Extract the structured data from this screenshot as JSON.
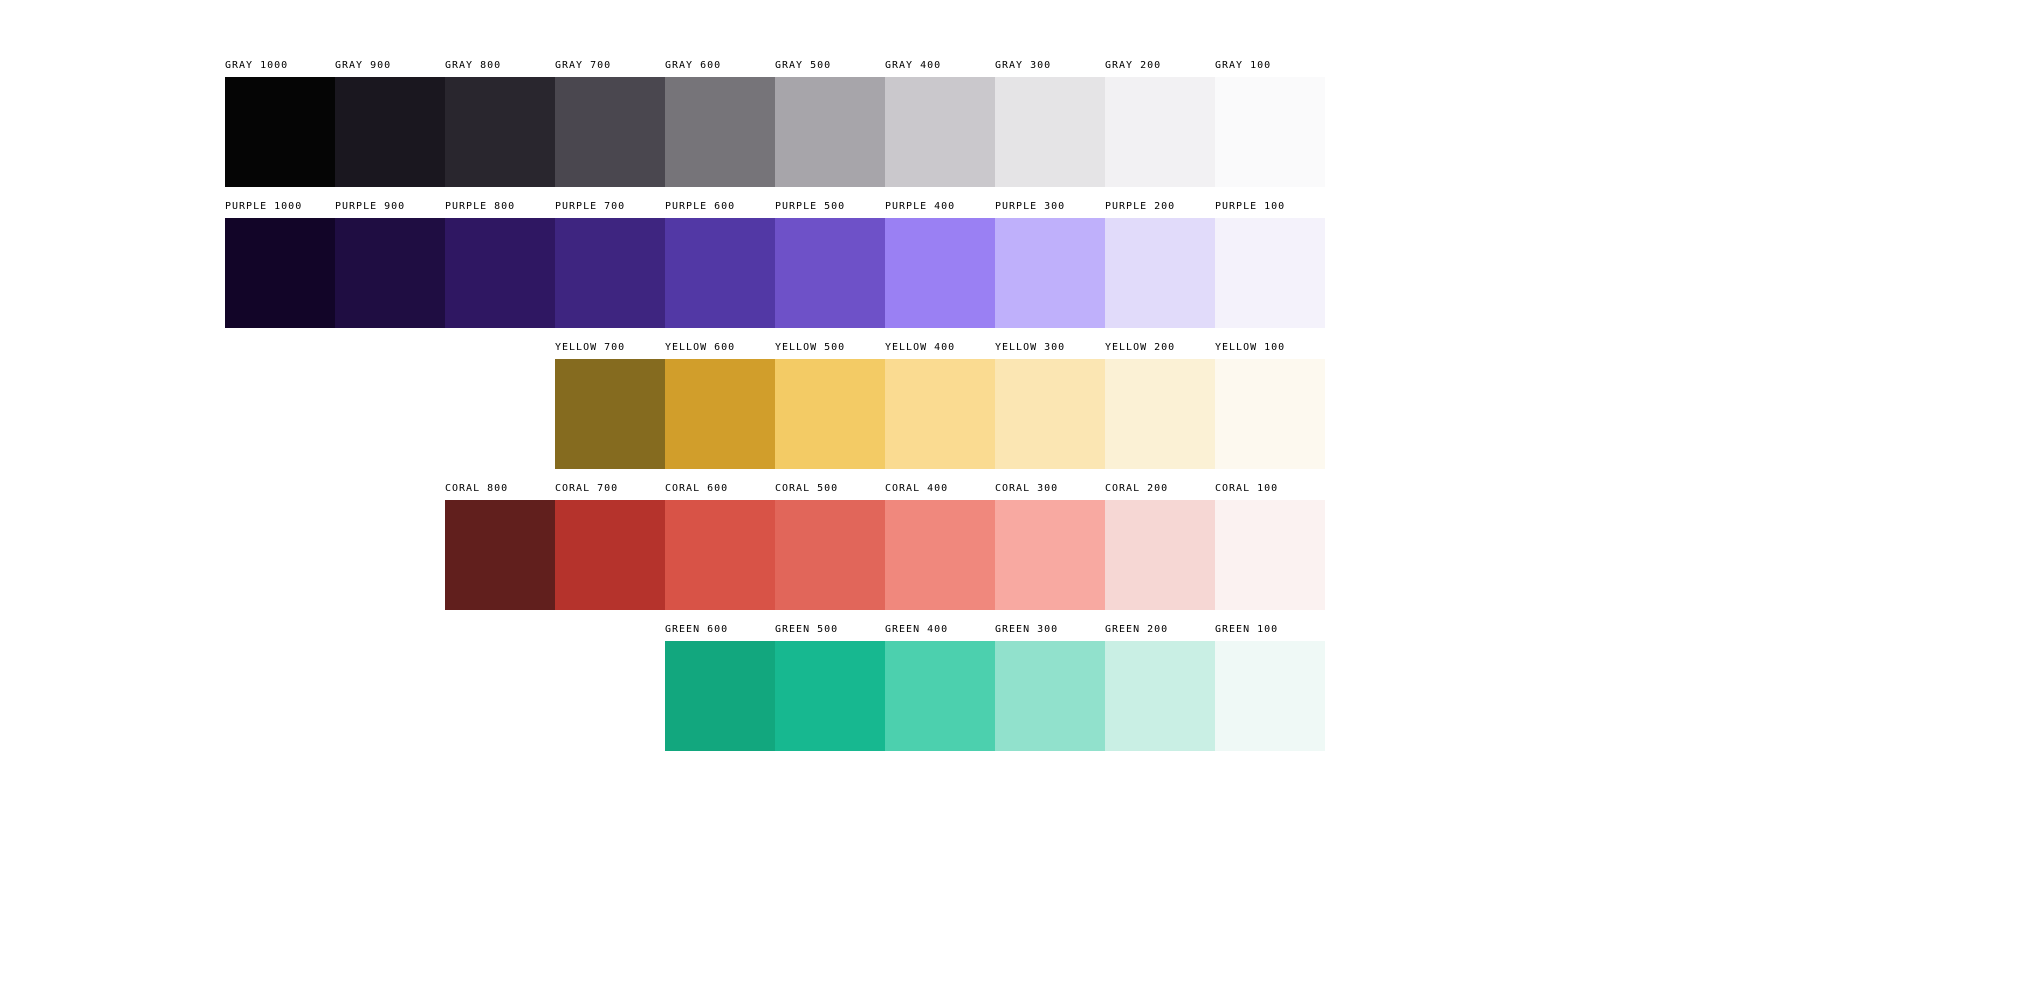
{
  "palette": {
    "rows": [
      {
        "name": "gray",
        "offset": 0,
        "swatches": [
          {
            "label": "GRAY 1000",
            "hex": "#050505"
          },
          {
            "label": "GRAY 900",
            "hex": "#1A171F"
          },
          {
            "label": "GRAY 800",
            "hex": "#29262E"
          },
          {
            "label": "GRAY 700",
            "hex": "#4A474F"
          },
          {
            "label": "GRAY 600",
            "hex": "#767479"
          },
          {
            "label": "GRAY 500",
            "hex": "#A7A5AA"
          },
          {
            "label": "GRAY 400",
            "hex": "#CAC8CC"
          },
          {
            "label": "GRAY 300",
            "hex": "#E5E4E6"
          },
          {
            "label": "GRAY 200",
            "hex": "#F2F1F3"
          },
          {
            "label": "GRAY 100",
            "hex": "#FAFAFB"
          }
        ]
      },
      {
        "name": "purple",
        "offset": 0,
        "swatches": [
          {
            "label": "PURPLE 1000",
            "hex": "#120528"
          },
          {
            "label": "PURPLE 900",
            "hex": "#1F0D42"
          },
          {
            "label": "PURPLE 800",
            "hex": "#2F1762"
          },
          {
            "label": "PURPLE 700",
            "hex": "#3E2580"
          },
          {
            "label": "PURPLE 600",
            "hex": "#5238A5"
          },
          {
            "label": "PURPLE 500",
            "hex": "#6E51C8"
          },
          {
            "label": "PURPLE 400",
            "hex": "#9A80F3"
          },
          {
            "label": "PURPLE 300",
            "hex": "#BFB0FB"
          },
          {
            "label": "PURPLE 200",
            "hex": "#E1DBFA"
          },
          {
            "label": "PURPLE 100",
            "hex": "#F4F2FB"
          }
        ]
      },
      {
        "name": "yellow",
        "offset": 3,
        "swatches": [
          {
            "label": "YELLOW 700",
            "hex": "#856B1F"
          },
          {
            "label": "YELLOW 600",
            "hex": "#D19E2B"
          },
          {
            "label": "YELLOW 500",
            "hex": "#F3CB65"
          },
          {
            "label": "YELLOW 400",
            "hex": "#FADB91"
          },
          {
            "label": "YELLOW 300",
            "hex": "#FBE6B3"
          },
          {
            "label": "YELLOW 200",
            "hex": "#FBF1D5"
          },
          {
            "label": "YELLOW 100",
            "hex": "#FDF9EF"
          }
        ]
      },
      {
        "name": "coral",
        "offset": 2,
        "swatches": [
          {
            "label": "CORAL 800",
            "hex": "#611F1D"
          },
          {
            "label": "CORAL 700",
            "hex": "#B5332C"
          },
          {
            "label": "CORAL 600",
            "hex": "#D85347"
          },
          {
            "label": "CORAL 500",
            "hex": "#E1665A"
          },
          {
            "label": "CORAL 400",
            "hex": "#F0887D"
          },
          {
            "label": "CORAL 300",
            "hex": "#F8A9A1"
          },
          {
            "label": "CORAL 200",
            "hex": "#F6D7D4"
          },
          {
            "label": "CORAL 100",
            "hex": "#FBF2F1"
          }
        ]
      },
      {
        "name": "green",
        "offset": 4,
        "swatches": [
          {
            "label": "GREEN 600",
            "hex": "#12A77E"
          },
          {
            "label": "GREEN 500",
            "hex": "#17B890"
          },
          {
            "label": "GREEN 400",
            "hex": "#4CD0AE"
          },
          {
            "label": "GREEN 300",
            "hex": "#91E1CC"
          },
          {
            "label": "GREEN 200",
            "hex": "#C9EFE4"
          },
          {
            "label": "GREEN 100",
            "hex": "#EFF9F6"
          }
        ]
      }
    ]
  }
}
